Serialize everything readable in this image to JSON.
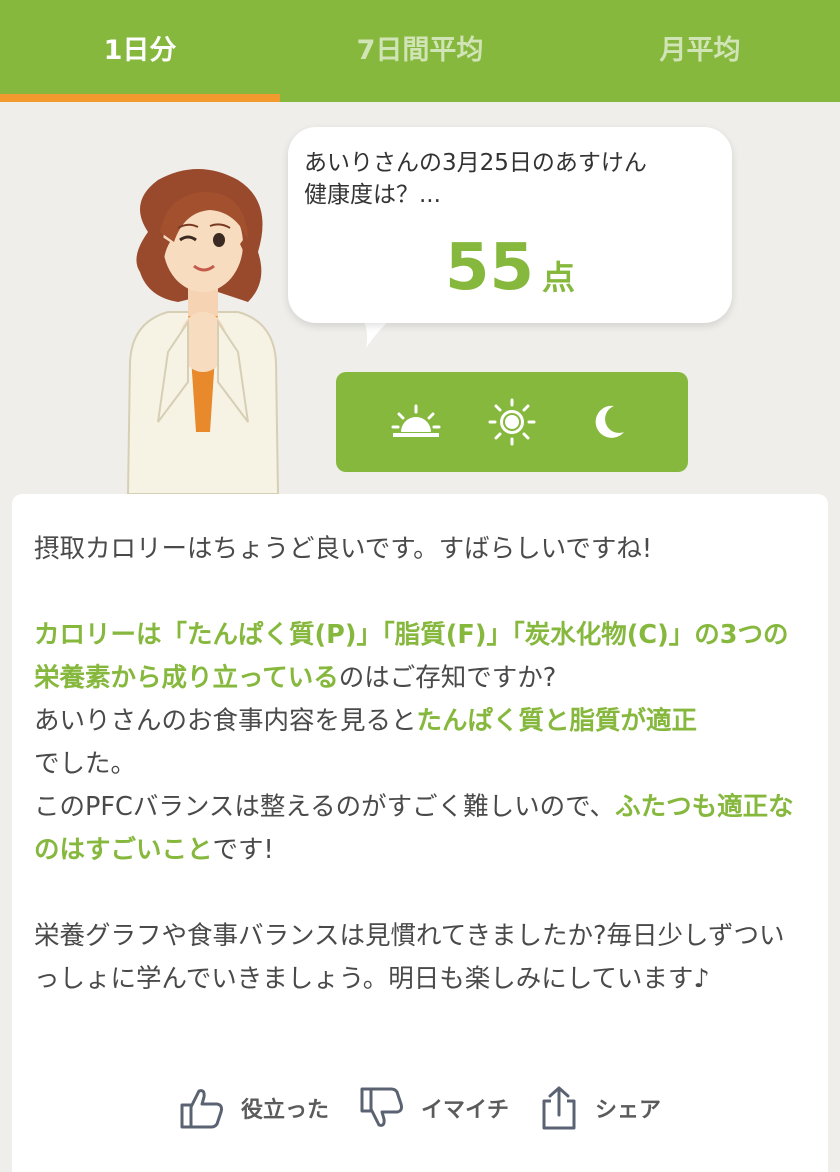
{
  "tabs": [
    {
      "label": "1日分",
      "active": true
    },
    {
      "label": "7日間平均",
      "active": false
    },
    {
      "label": "月平均",
      "active": false
    }
  ],
  "bubble": {
    "line1": "あいりさんの3月25日のあすけん",
    "line2": "健康度は？...",
    "score": "55",
    "score_unit": "点"
  },
  "time_of_day": [
    {
      "icon": "sunrise-icon"
    },
    {
      "icon": "sun-icon"
    },
    {
      "icon": "moon-icon"
    }
  ],
  "advice": {
    "p1": "摂取カロリーはちょうど良いです。すばらしいですね!",
    "p2": {
      "s1": "カロリーは「たんぱく質(P)」「脂質(F)」「炭水化物(C)」の3つの栄養素から成り立っている",
      "s2": "のはご存知ですか?",
      "s3": "あいりさんのお食事内容を見ると",
      "s4": "たんぱく質と脂質が適正",
      "s5": "でした。",
      "s6": "このPFCバランスは整えるのがすごく難しいので、",
      "s7": "ふたつも適正なのはすごいこと",
      "s8": "です!"
    },
    "p3": "栄養グラフや食事バランスは見慣れてきましたか?毎日少しずついっしょに学んでいきましょう。明日も楽しみにしています♪"
  },
  "actions": [
    {
      "icon": "thumbs-up-icon",
      "label": "役立った"
    },
    {
      "icon": "thumbs-down-icon",
      "label": "イマイチ"
    },
    {
      "icon": "share-icon",
      "label": "シェア"
    }
  ],
  "colors": {
    "brand_green": "#86b83e",
    "tab_indicator": "#f29a2e",
    "background": "#efeeea"
  }
}
